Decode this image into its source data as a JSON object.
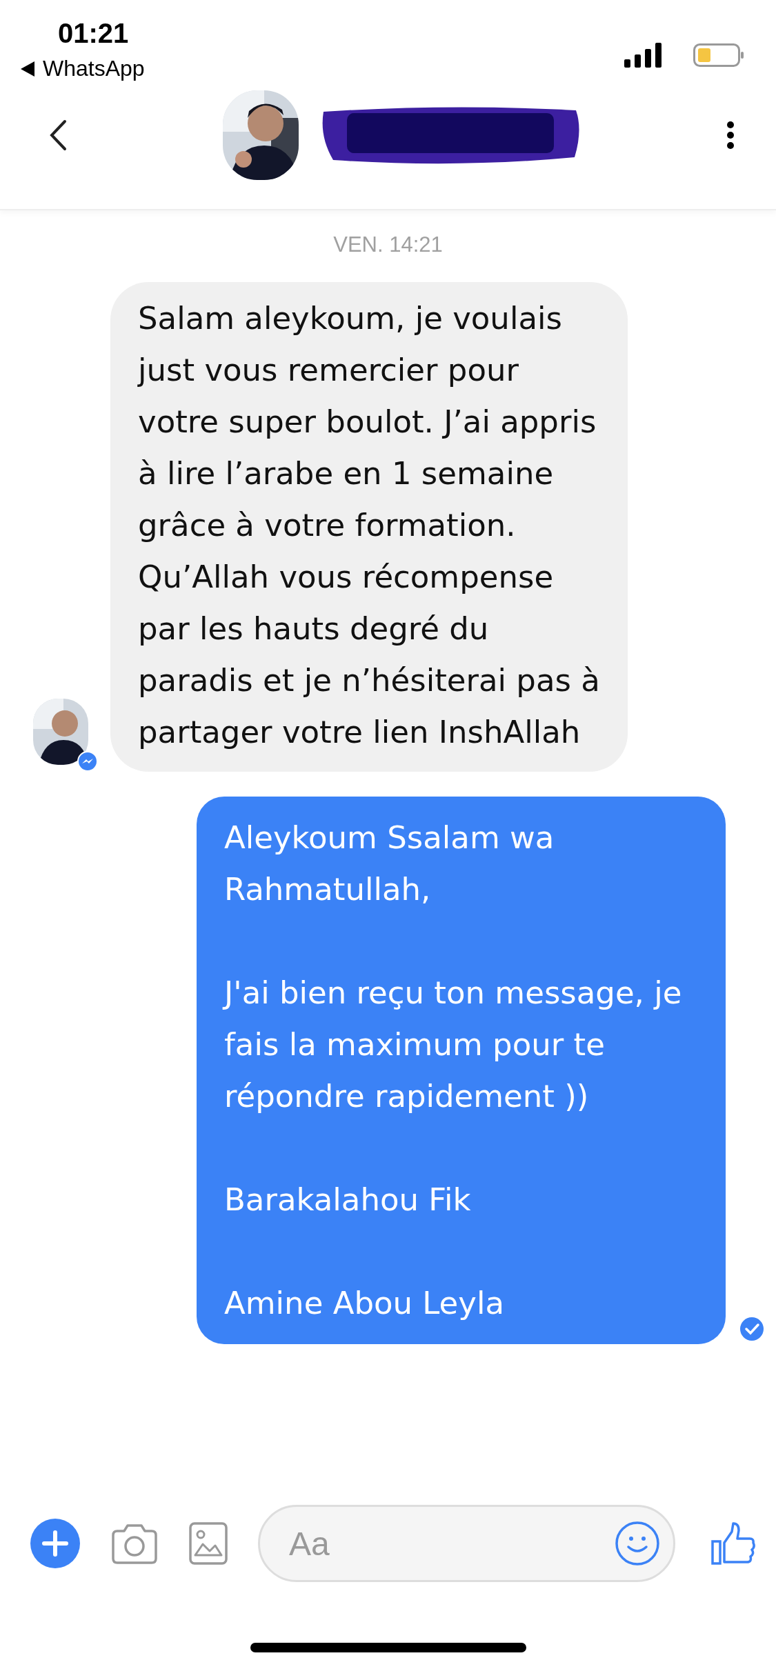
{
  "status_bar": {
    "time": "01:21",
    "back_app": "WhatsApp"
  },
  "header": {
    "name_redacted": true
  },
  "day_stamp": "VEN. 14:21",
  "messages": [
    {
      "kind": "incoming",
      "text": "Salam aleykoum, je voulais just vous remercier pour votre super boulot. J’ai appris à lire l’arabe en 1 semaine grâce à votre formation. Qu’Allah vous récompense par les hauts degré du paradis et je n’hésiterai pas à partager votre lien InshAllah"
    },
    {
      "kind": "outgoing",
      "text": "Aleykoum Ssalam wa Rahmatullah,\n\nJ'ai bien reçu ton message, je fais la maximum pour te répondre rapidement ))\n\nBarakalahou Fik\n\nAmine Abou Leyla",
      "seen": true
    }
  ],
  "composer": {
    "placeholder": "Aa"
  }
}
